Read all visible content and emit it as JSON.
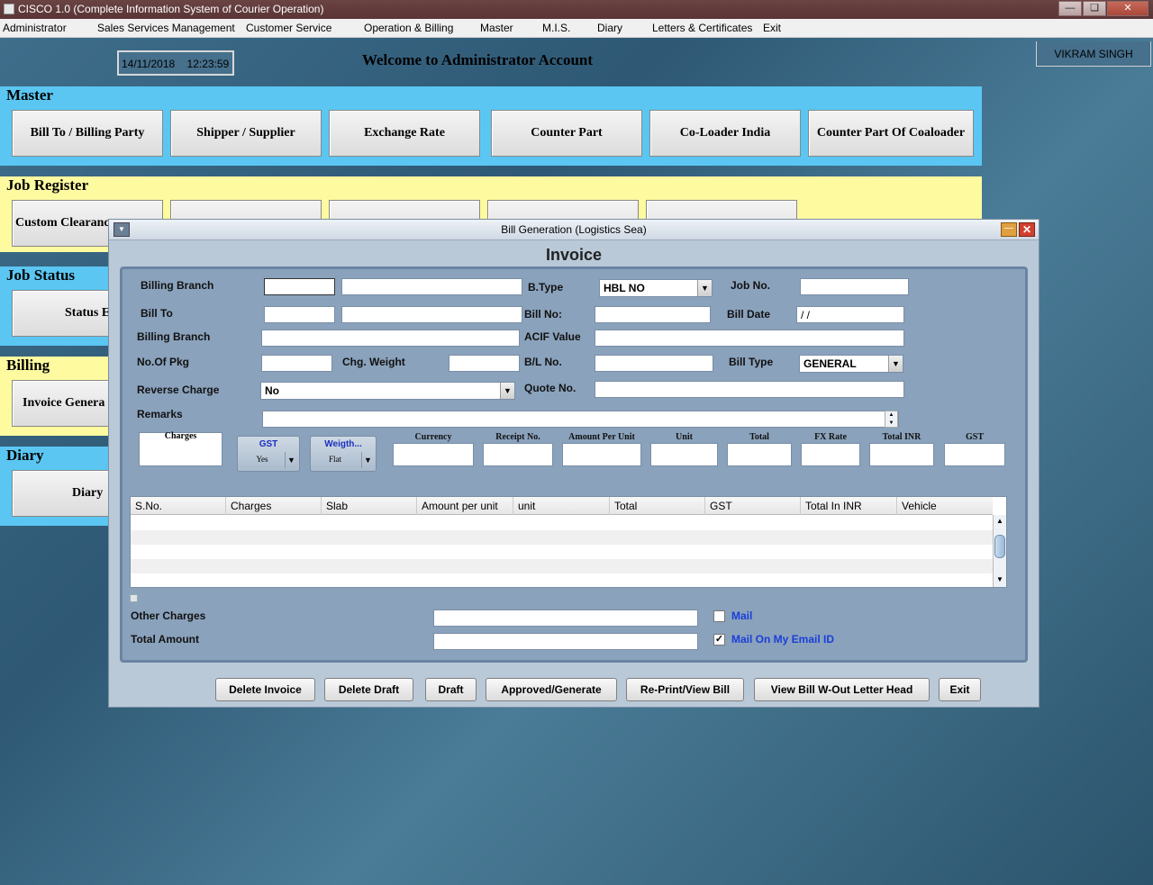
{
  "window": {
    "title": "CISCO 1.0 (Complete Information System of Courier Operation)"
  },
  "menu": [
    "Administrator",
    "Sales Services Management",
    "Customer Service",
    "Operation & Billing",
    "Master",
    "M.I.S.",
    "Diary",
    "Letters & Certificates",
    "Exit"
  ],
  "header": {
    "date": "14/11/2018",
    "time": "12:23:59",
    "welcome": "Welcome to Administrator Account",
    "user": "VIKRAM SINGH"
  },
  "sections": {
    "master": {
      "title": "Master",
      "buttons": [
        "Bill To / Billing Party",
        "Shipper / Supplier",
        "Exchange Rate",
        "Counter Part",
        "Co-Loader India",
        "Counter Part Of Coaloader"
      ]
    },
    "job_register": {
      "title": "Job Register",
      "buttons": [
        "Custom Clearance",
        "",
        "",
        "",
        ""
      ]
    },
    "job_status": {
      "title": "Job Status",
      "buttons": [
        "Status E"
      ]
    },
    "billing": {
      "title": "Billing",
      "buttons": [
        "Invoice Genera"
      ]
    },
    "diary": {
      "title": "Diary",
      "buttons": [
        "Diary"
      ]
    }
  },
  "dialog": {
    "title": "Bill Generation (Logistics Sea)",
    "heading": "Invoice",
    "form": {
      "billing_branch_label": "Billing  Branch",
      "bill_to_label": "Bill To",
      "billing_branch2_label": "Billing Branch",
      "no_of_pkg_label": "No.Of Pkg",
      "chg_weight_label": "Chg. Weight",
      "reverse_charge_label": "Reverse Charge",
      "reverse_charge_value": "No",
      "remarks_label": "Remarks",
      "btype_label": "B.Type",
      "btype_value": "HBL NO",
      "job_no_label": "Job No.",
      "bill_no_label": "Bill No:",
      "bill_date_label": "Bill Date",
      "bill_date_value": " / /",
      "acif_label": "ACIF Value",
      "bl_no_label": "B/L No.",
      "bill_type_label": "Bill Type",
      "bill_type_value": "GENERAL",
      "quote_no_label": "Quote No."
    },
    "charge_entry": {
      "charges_label": "Charges",
      "gst": {
        "label": "GST",
        "value": "Yes"
      },
      "weight": {
        "label": "Weigth...",
        "value": "Flat"
      },
      "fields": [
        "Currency",
        "Receipt No.",
        "Amount Per Unit",
        "Unit",
        "Total",
        "FX Rate",
        "Total INR",
        "GST"
      ]
    },
    "grid": {
      "columns": [
        "S.No.",
        "Charges",
        "Slab",
        "Amount per unit",
        "unit",
        "Total",
        "GST",
        "Total In INR",
        "Vehicle"
      ]
    },
    "other_charges_label": "Other Charges",
    "total_amount_label": "Total Amount",
    "mail_label": "Mail",
    "mail_checked": false,
    "mail_my_email_label": "Mail On My Email ID",
    "mail_my_email_checked": true,
    "buttons": [
      "Delete Invoice",
      "Delete Draft",
      "Draft",
      "Approved/Generate",
      "Re-Print/View Bill",
      "View Bill W-Out Letter Head",
      "Exit"
    ]
  }
}
